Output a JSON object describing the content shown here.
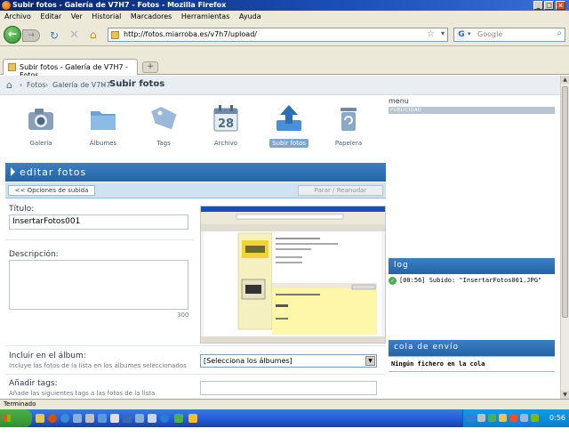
{
  "window": {
    "title": "Subir fotos - Galería de V7H7 - Fotos - Mozilla Firefox",
    "minimize": "_",
    "maximize": "□",
    "close": "×"
  },
  "menubar": [
    "Archivo",
    "Editar",
    "Ver",
    "Historial",
    "Marcadores",
    "Herramientas",
    "Ayuda"
  ],
  "navbar": {
    "url": "http://fotos.miarroba.es/v7h7/upload/",
    "search_placeholder": "Google"
  },
  "tabs": [
    {
      "label": "Subir fotos - Galería de V7H7 - Fotos"
    }
  ],
  "breadcrumb": {
    "items": [
      "Fotos",
      "Galería de V7H7"
    ],
    "current": "Subir fotos",
    "separator": "›"
  },
  "icons": [
    {
      "label": "Galería",
      "icon": "camera-icon"
    },
    {
      "label": "Álbumes",
      "icon": "folder-icon"
    },
    {
      "label": "Tags",
      "icon": "tag-icon"
    },
    {
      "label": "Archivo",
      "icon": "calendar-icon",
      "day": "28"
    },
    {
      "label": "Subir fotos",
      "icon": "upload-icon",
      "selected": true
    },
    {
      "label": "Papelera",
      "icon": "trash-icon"
    }
  ],
  "edit": {
    "header": "editar fotos",
    "options_button": "<< Opciones de subida",
    "pause_button": "Parar / Reanudar",
    "title_label": "Título:",
    "title_value": "InsertarFotos001",
    "description_label": "Descripción:",
    "char_count": "300",
    "album_label": "Incluir en el álbum:",
    "album_sub": "Incluye las fotos de la lista en los álbumes seleccionados",
    "album_select": "[Selecciona los álbumes]",
    "tags_label": "Añadir tags:",
    "tags_sub": "Añade las siguientes tags a las fotos de la lista"
  },
  "sidebar": {
    "menu_label": "menu",
    "pub_label": "PUBLICIDAD",
    "log_header": "log",
    "log_entry": "[00:56] Subido: \"InsertarFotos001.JPG\"",
    "queue_header": "cola de envío",
    "queue_empty": "Ningún fichero en la cola"
  },
  "status": "Terminado",
  "taskbar": {
    "start": "Inicio",
    "clock": "0:56"
  },
  "colors": {
    "accent_blue": "#2e6fb5",
    "title_bar": "#0a246a",
    "chrome": "#ece9d8"
  }
}
